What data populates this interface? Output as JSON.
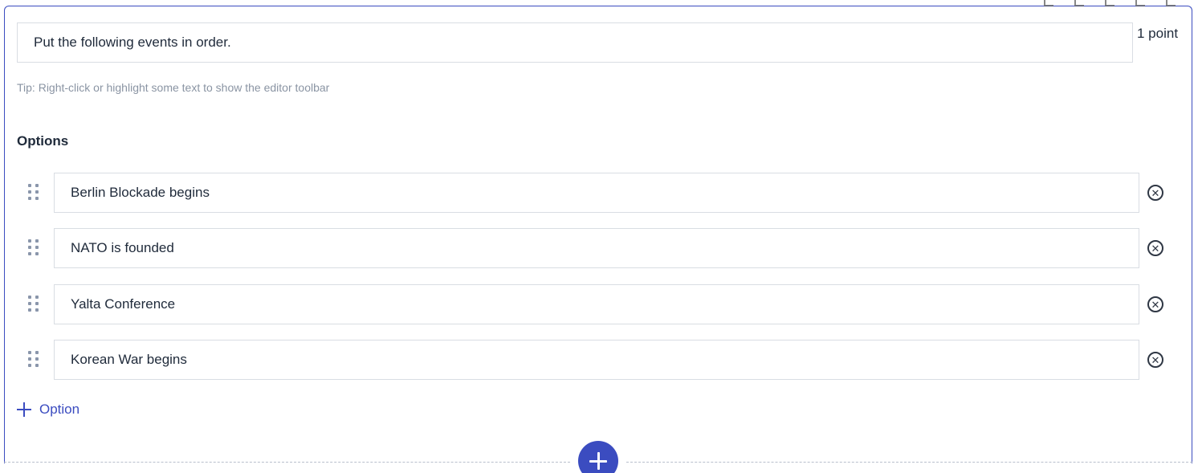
{
  "question": {
    "text": "Put the following events in order.",
    "points": "1 point",
    "tip": "Tip: Right-click or highlight some text to show the editor toolbar"
  },
  "options": {
    "title": "Options",
    "items": [
      {
        "label": "Berlin Blockade begins"
      },
      {
        "label": "NATO is founded"
      },
      {
        "label": "Yalta Conference"
      },
      {
        "label": "Korean War begins"
      }
    ],
    "add_label": "Option",
    "remove_glyph": "✕"
  },
  "icons": {
    "drag": "drag-handle-icon",
    "remove": "close-circle-icon",
    "add": "plus-icon"
  },
  "colors": {
    "accent": "#3b4cc0",
    "text": "#1f2a3a",
    "muted": "#8a94a3"
  }
}
